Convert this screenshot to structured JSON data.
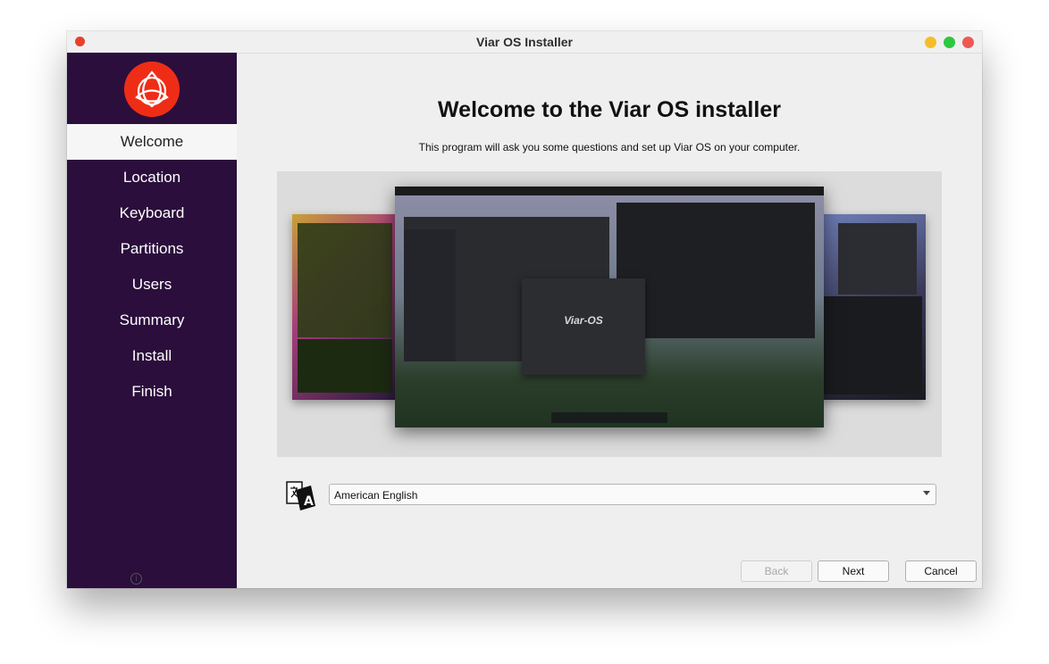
{
  "window": {
    "title": "Viar OS Installer"
  },
  "sidebar": {
    "items": [
      {
        "label": "Welcome",
        "active": true
      },
      {
        "label": "Location"
      },
      {
        "label": "Keyboard"
      },
      {
        "label": "Partitions"
      },
      {
        "label": "Users"
      },
      {
        "label": "Summary"
      },
      {
        "label": "Install"
      },
      {
        "label": "Finish"
      }
    ],
    "about_label": "About"
  },
  "main": {
    "heading": "Welcome to the Viar OS installer",
    "subtitle": "This program will ask you some questions and set up Viar OS on your computer.",
    "preview_about_title": "Viar-OS",
    "language": {
      "selected": "American English"
    }
  },
  "buttons": {
    "back": "Back",
    "next": "Next",
    "cancel": "Cancel"
  },
  "colors": {
    "sidebar_bg": "#2b0e3c",
    "logo_red": "#ef2d17",
    "content_bg": "#efefef",
    "close": "#ee5a52",
    "minimize": "#f5bd28",
    "maximize": "#2cc83f"
  }
}
